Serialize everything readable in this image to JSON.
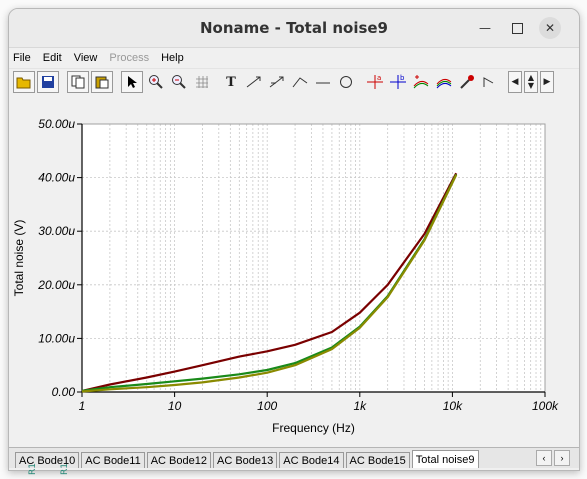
{
  "window": {
    "title": "Noname - Total noise9"
  },
  "menu": [
    "File",
    "Edit",
    "View",
    "Process",
    "Help"
  ],
  "chart_data": {
    "type": "line",
    "xlabel": "Frequency (Hz)",
    "ylabel": "Total noise (V)",
    "x_scale": "log",
    "xlim": [
      1,
      100000
    ],
    "ylim": [
      0,
      50
    ],
    "x_ticks": [
      "1",
      "10",
      "100",
      "1k",
      "10k",
      "100k"
    ],
    "y_ticks": [
      "0.00",
      "10.00u",
      "20.00u",
      "30.00u",
      "40.00u",
      "50.00u"
    ],
    "grid": true,
    "series": [
      {
        "color": "#7a0000",
        "x": [
          1,
          2,
          5,
          10,
          20,
          50,
          100,
          200,
          500,
          1000,
          2000,
          5000,
          11000
        ],
        "y": [
          0.2,
          1.4,
          2.7,
          3.8,
          5.0,
          6.6,
          7.6,
          8.8,
          11.2,
          14.8,
          20.0,
          29.5,
          40.8
        ]
      },
      {
        "color": "#1a8a1a",
        "x": [
          1,
          2,
          5,
          10,
          20,
          50,
          100,
          200,
          500,
          1000,
          2000,
          5000,
          11000
        ],
        "y": [
          0.2,
          0.9,
          1.5,
          2.0,
          2.5,
          3.3,
          4.1,
          5.4,
          8.3,
          12.2,
          17.9,
          28.5,
          40.6
        ]
      },
      {
        "color": "#8a8a00",
        "x": [
          1,
          2,
          5,
          10,
          20,
          50,
          100,
          200,
          500,
          1000,
          2000,
          5000,
          11000
        ],
        "y": [
          0.1,
          0.5,
          0.9,
          1.3,
          1.8,
          2.7,
          3.6,
          5.0,
          8.0,
          12.0,
          17.7,
          28.3,
          40.5
        ]
      }
    ]
  },
  "tabs": [
    "AC Bode10",
    "AC Bode11",
    "AC Bode12",
    "AC Bode13",
    "AC Bode14",
    "AC Bode15",
    "Total noise9"
  ],
  "active_tab": "Total noise9",
  "outside_labels": [
    "R1",
    "R1"
  ]
}
